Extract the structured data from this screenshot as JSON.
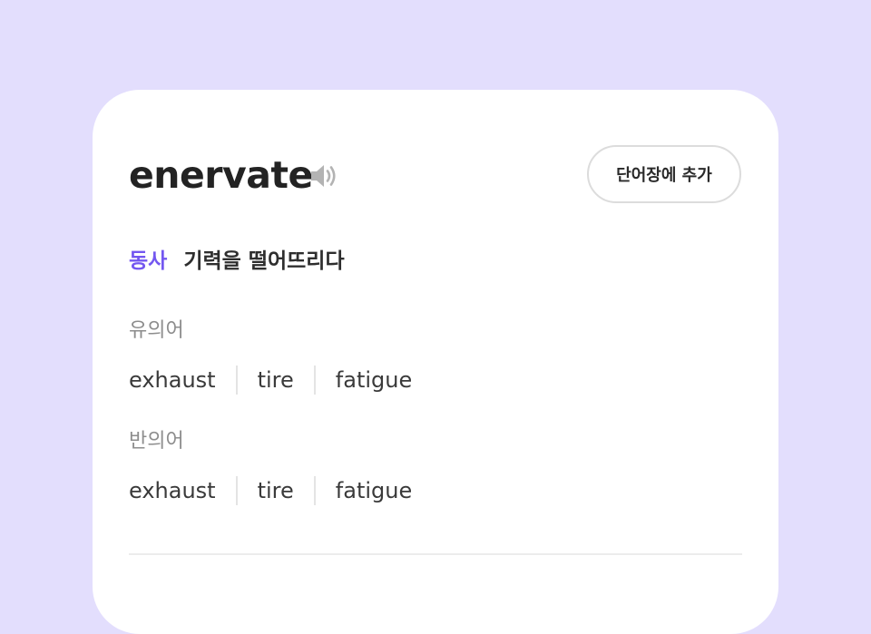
{
  "entry": {
    "word": "enervate",
    "add_button_label": "단어장에 추가",
    "part_of_speech": "동사",
    "meaning": "기력을 떨어뜨리다"
  },
  "synonyms": {
    "label": "유의어",
    "words": [
      "exhaust",
      "tire",
      "fatigue"
    ]
  },
  "antonyms": {
    "label": "반의어",
    "words": [
      "exhaust",
      "tire",
      "fatigue"
    ]
  },
  "colors": {
    "background": "#e3defd",
    "card": "#ffffff",
    "accent": "#7357f0",
    "speaker_icon": "#b3b3b3"
  },
  "icons": {
    "pronunciation": "speaker-icon"
  }
}
